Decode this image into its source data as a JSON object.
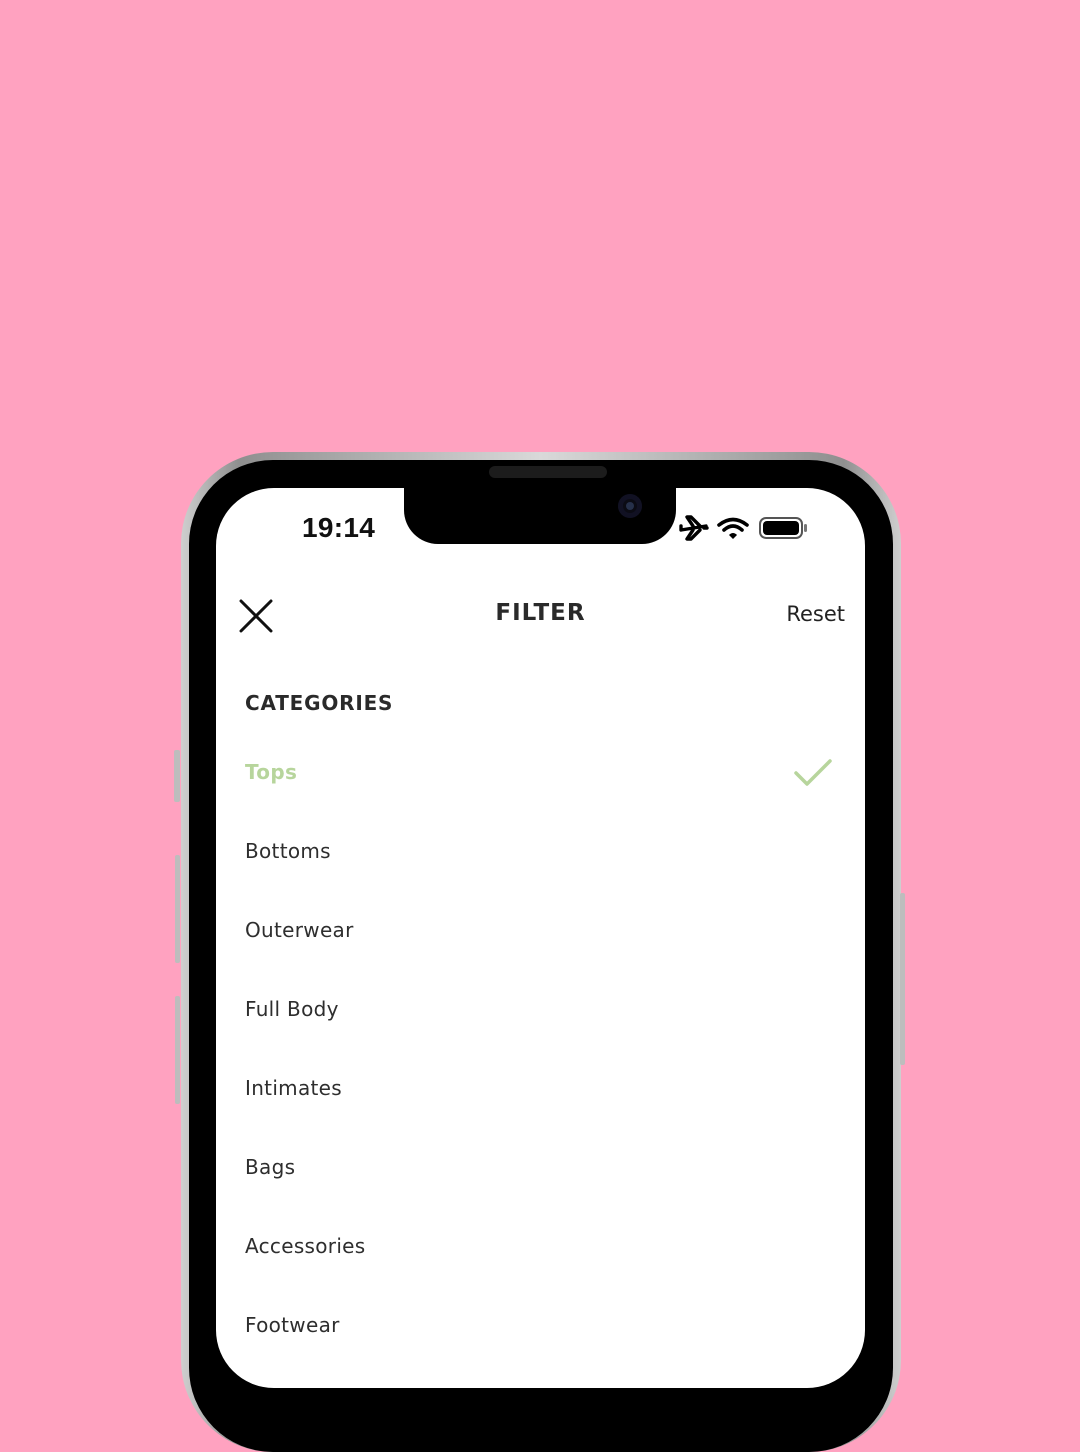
{
  "colors": {
    "background": "#ffa2c0",
    "accent": "#b7d59c",
    "text": "#2e2e2e"
  },
  "status_bar": {
    "time": "19:14",
    "icons": [
      "airplane-icon",
      "wifi-icon",
      "battery-icon"
    ]
  },
  "header": {
    "title": "FILTER",
    "close_icon": "close-icon",
    "reset_label": "Reset"
  },
  "categories": {
    "title": "CATEGORIES",
    "items": [
      {
        "label": "Tops",
        "selected": true
      },
      {
        "label": "Bottoms",
        "selected": false
      },
      {
        "label": "Outerwear",
        "selected": false
      },
      {
        "label": "Full Body",
        "selected": false
      },
      {
        "label": "Intimates",
        "selected": false
      },
      {
        "label": "Bags",
        "selected": false
      },
      {
        "label": "Accessories",
        "selected": false
      },
      {
        "label": "Footwear",
        "selected": false
      }
    ],
    "selected_icon": "check-icon"
  }
}
